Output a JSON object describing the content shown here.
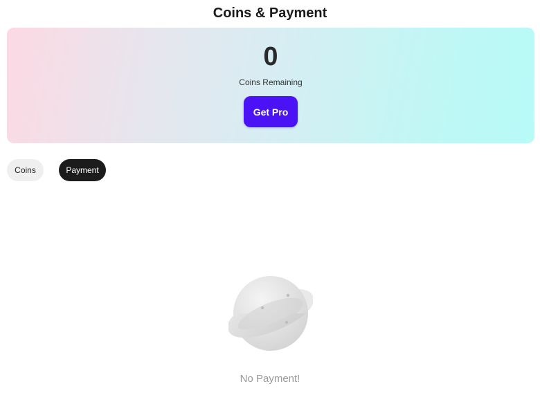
{
  "header": {
    "title": "Coins & Payment"
  },
  "coins_card": {
    "value": "0",
    "label": "Coins Remaining",
    "button_label": "Get Pro"
  },
  "tabs": [
    {
      "label": "Coins",
      "active": false
    },
    {
      "label": "Payment",
      "active": true
    }
  ],
  "empty_state": {
    "icon": "planet-icon",
    "message": "No Payment!"
  },
  "colors": {
    "accent": "#4a12f5",
    "active_tab": "#1c1c1c",
    "inactive_tab": "#efefef",
    "empty_text": "#999999"
  }
}
